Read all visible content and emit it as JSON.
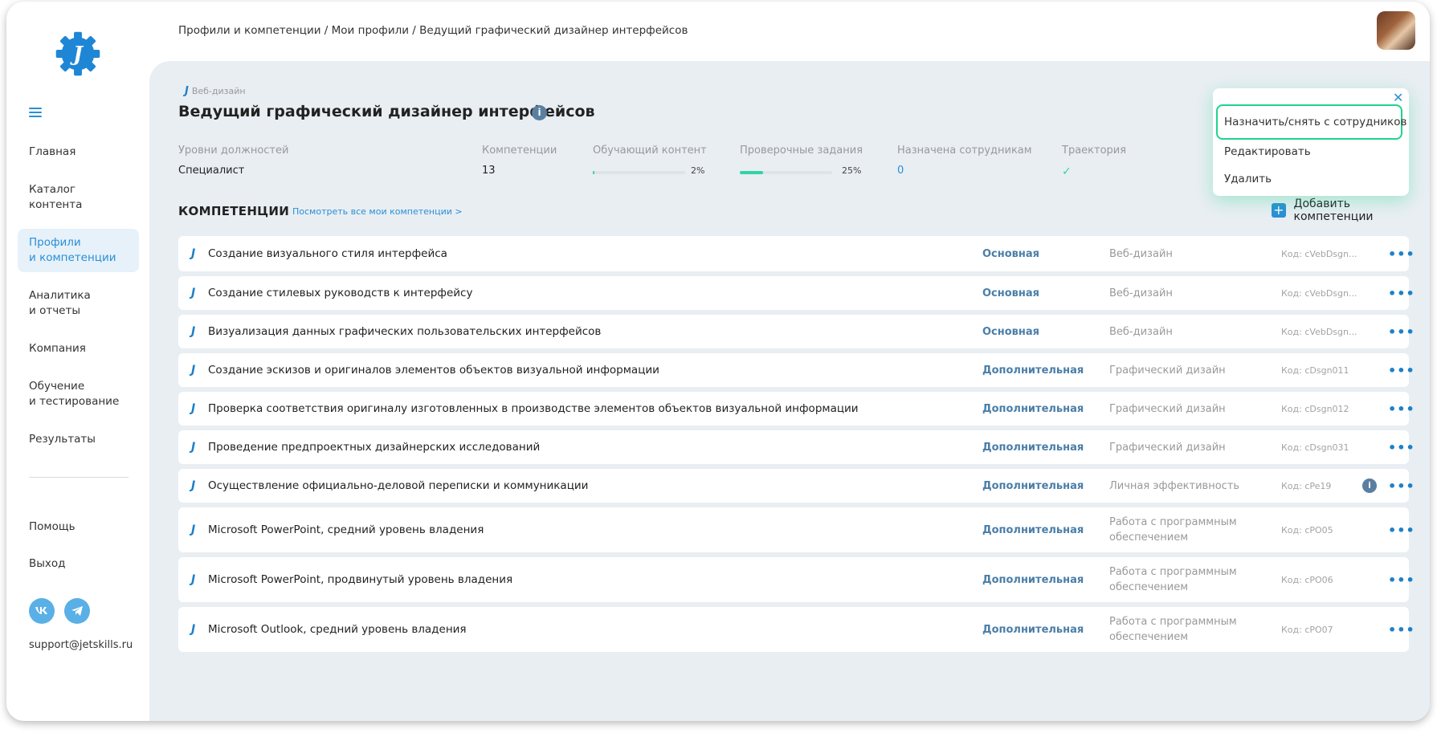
{
  "breadcrumb": "Профили и компетенции / Мои профили / Ведущий графический дизайнер интерфейсов",
  "sidebar": {
    "items": [
      {
        "label": "Главная"
      },
      {
        "label": "Каталог контента"
      },
      {
        "label": "Профили\nи компетенции",
        "active": true
      },
      {
        "label": "Аналитика\nи отчеты"
      },
      {
        "label": "Компания"
      },
      {
        "label": "Обучение\nи тестирование"
      },
      {
        "label": "Результаты"
      }
    ],
    "help": "Помощь",
    "logout": "Выход",
    "support_email": "support@jetskills.ru"
  },
  "profile": {
    "category": "Веб-дизайн",
    "title": "Ведущий графический дизайнер интерфейсов"
  },
  "stats": {
    "levels_label": "Уровни должностей",
    "levels_value": "Специалист",
    "competencies_label": "Компетенции",
    "competencies_value": "13",
    "learning_label": "Обучающий контент",
    "learning_pct": "2%",
    "learning_progress": 2,
    "tasks_label": "Проверочные задания",
    "tasks_pct": "25%",
    "tasks_progress": 25,
    "assigned_label": "Назначена сотрудникам",
    "assigned_value": "0",
    "trajectory_label": "Траектория"
  },
  "competencies_section": {
    "heading": "КОМПЕТЕНЦИИ",
    "view_all": "Посмотреть все мои компетенции >",
    "add_label": "Добавить компетенции"
  },
  "popup_menu": {
    "items": [
      "Назначить/снять с сотрудников",
      "Редактировать",
      "Удалить"
    ]
  },
  "competencies": [
    {
      "name": "Создание визуального стиля интерфейса",
      "type": "Основная",
      "area": "Веб-дизайн",
      "code": "Код: cVebDsgn..."
    },
    {
      "name": "Создание стилевых руководств к интерфейсу",
      "type": "Основная",
      "area": "Веб-дизайн",
      "code": "Код: cVebDsgn..."
    },
    {
      "name": "Визуализация данных графических пользовательских интерфейсов",
      "type": "Основная",
      "area": "Веб-дизайн",
      "code": "Код: cVebDsgn..."
    },
    {
      "name": "Создание эскизов и оригиналов элементов объектов визуальной информации",
      "type": "Дополнительная",
      "area": "Графический дизайн",
      "code": "Код: cDsgn011"
    },
    {
      "name": "Проверка соответствия оригиналу изготовленных в производстве элементов объектов визуальной информации",
      "type": "Дополнительная",
      "area": "Графический дизайн",
      "code": "Код: cDsgn012"
    },
    {
      "name": "Проведение предпроектных дизайнерских исследований",
      "type": "Дополнительная",
      "area": "Графический дизайн",
      "code": "Код: cDsgn031"
    },
    {
      "name": "Осуществление официально-деловой переписки и коммуникации",
      "type": "Дополнительная",
      "area": "Личная эффективность",
      "code": "Код: cPe19",
      "info": true
    },
    {
      "name": "Microsoft PowerPoint, средний уровень владения",
      "type": "Дополнительная",
      "area": "Работа с программным\nобеспечением",
      "code": "Код: cPO05"
    },
    {
      "name": "Microsoft PowerPoint, продвинутый уровень владения",
      "type": "Дополнительная",
      "area": "Работа с программным\nобеспечением",
      "code": "Код: cPO06"
    },
    {
      "name": "Microsoft Outlook, средний уровень владения",
      "type": "Дополнительная",
      "area": "Работа с программным\nобеспечением",
      "code": "Код: cPO07"
    }
  ]
}
